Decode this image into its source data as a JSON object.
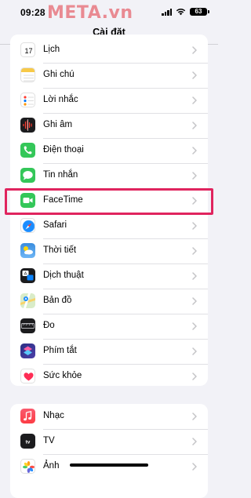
{
  "status_bar": {
    "time": "09:28",
    "battery": "63",
    "watermark": "META.vn"
  },
  "nav": {
    "title": "Cài đặt"
  },
  "group1": {
    "items": [
      {
        "label": "Lịch",
        "icon": "calendar-icon"
      },
      {
        "label": "Ghi chú",
        "icon": "notes-icon"
      },
      {
        "label": "Lời nhắc",
        "icon": "reminders-icon"
      },
      {
        "label": "Ghi âm",
        "icon": "voice-memos-icon"
      },
      {
        "label": "Điện thoại",
        "icon": "phone-icon"
      },
      {
        "label": "Tin nhắn",
        "icon": "messages-icon"
      },
      {
        "label": "FaceTime",
        "icon": "facetime-icon"
      },
      {
        "label": "Safari",
        "icon": "safari-icon",
        "highlighted": true
      },
      {
        "label": "Thời tiết",
        "icon": "weather-icon"
      },
      {
        "label": "Dịch thuật",
        "icon": "translate-icon"
      },
      {
        "label": "Bản đồ",
        "icon": "maps-icon"
      },
      {
        "label": "Đo",
        "icon": "measure-icon"
      },
      {
        "label": "Phím tắt",
        "icon": "shortcuts-icon"
      },
      {
        "label": "Sức khỏe",
        "icon": "health-icon"
      }
    ]
  },
  "group2": {
    "items": [
      {
        "label": "Nhạc",
        "icon": "music-icon"
      },
      {
        "label": "TV",
        "icon": "tv-icon"
      },
      {
        "label": "Ảnh",
        "icon": "photos-icon"
      }
    ]
  },
  "colors": {
    "highlight": "#e0245e",
    "background": "#f2f2f7",
    "chevron": "#c4c4c7"
  }
}
